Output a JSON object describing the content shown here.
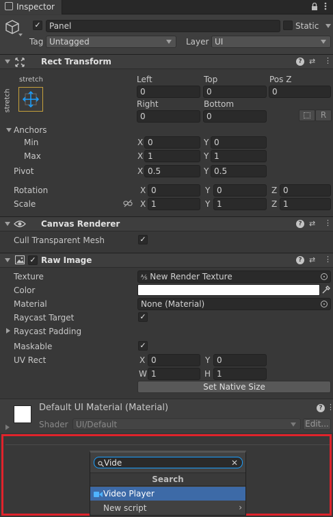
{
  "tab": {
    "title": "Inspector"
  },
  "gameobject": {
    "name": "Panel",
    "static_label": "Static",
    "tag_label": "Tag",
    "tag_value": "Untagged",
    "layer_label": "Layer",
    "layer_value": "UI"
  },
  "rect_transform": {
    "title": "Rect Transform",
    "anchor_h": "stretch",
    "anchor_v": "stretch",
    "left_label": "Left",
    "left": "0",
    "top_label": "Top",
    "top": "0",
    "posz_label": "Pos Z",
    "posz": "0",
    "right_label": "Right",
    "right": "0",
    "bottom_label": "Bottom",
    "bottom": "0",
    "r_button": "R",
    "anchors_label": "Anchors",
    "min_label": "Min",
    "min_x": "0",
    "min_y": "0",
    "max_label": "Max",
    "max_x": "1",
    "max_y": "1",
    "pivot_label": "Pivot",
    "pivot_x": "0.5",
    "pivot_y": "0.5",
    "rotation_label": "Rotation",
    "rot_x": "0",
    "rot_y": "0",
    "rot_z": "0",
    "scale_label": "Scale",
    "scale_x": "1",
    "scale_y": "1",
    "scale_z": "1",
    "axis_x": "X",
    "axis_y": "Y",
    "axis_z": "Z",
    "axis_w": "W",
    "axis_h": "H"
  },
  "canvas_renderer": {
    "title": "Canvas Renderer",
    "cull_label": "Cull Transparent Mesh"
  },
  "raw_image": {
    "title": "Raw Image",
    "texture_label": "Texture",
    "texture_value": "New Render Texture",
    "color_label": "Color",
    "color_value": "#ffffff",
    "material_label": "Material",
    "material_value": "None (Material)",
    "raycast_target_label": "Raycast Target",
    "raycast_padding_label": "Raycast Padding",
    "maskable_label": "Maskable",
    "uvrect_label": "UV Rect",
    "uv_x": "0",
    "uv_y": "0",
    "uv_w": "1",
    "uv_h": "1",
    "native_size_button": "Set Native Size"
  },
  "material": {
    "title": "Default UI Material (Material)",
    "shader_label": "Shader",
    "shader_value": "UI/Default",
    "edit_button": "Edit..."
  },
  "popup": {
    "search_value": "Vide",
    "header": "Search",
    "items": [
      "Video Player",
      "New script"
    ]
  },
  "colors": {
    "highlight": "#3d6aa7",
    "red_frame": "#e0232b",
    "accent_blue": "#1a9fff"
  }
}
